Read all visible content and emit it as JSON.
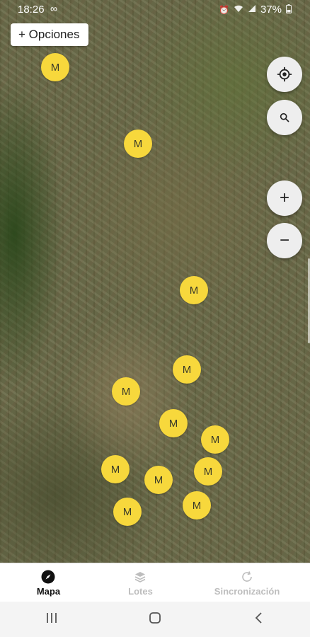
{
  "status_bar": {
    "time": "18:26",
    "infinity_icon": "∞",
    "battery": "37%",
    "icons": [
      "alarm-icon",
      "wifi-icon",
      "signal-icon",
      "battery-icon"
    ]
  },
  "options_button": {
    "label": "+ Opciones"
  },
  "map_controls": {
    "locate": "crosshair-icon",
    "search": "search-icon",
    "zoom_in": "+",
    "zoom_out": "−"
  },
  "markers": [
    {
      "label": "M"
    },
    {
      "label": "M"
    },
    {
      "label": "M"
    },
    {
      "label": "M"
    },
    {
      "label": "M"
    },
    {
      "label": "M"
    },
    {
      "label": "M"
    },
    {
      "label": "M"
    },
    {
      "label": "M"
    },
    {
      "label": "M"
    },
    {
      "label": "M"
    },
    {
      "label": "M"
    }
  ],
  "bottom_nav": {
    "items": [
      {
        "label": "Mapa",
        "icon": "compass-icon",
        "active": true
      },
      {
        "label": "Lotes",
        "icon": "layers-icon",
        "active": false
      },
      {
        "label": "Sincronización",
        "icon": "sync-icon",
        "active": false
      }
    ]
  },
  "system_nav": [
    "recent-apps-icon",
    "home-icon",
    "back-icon"
  ]
}
